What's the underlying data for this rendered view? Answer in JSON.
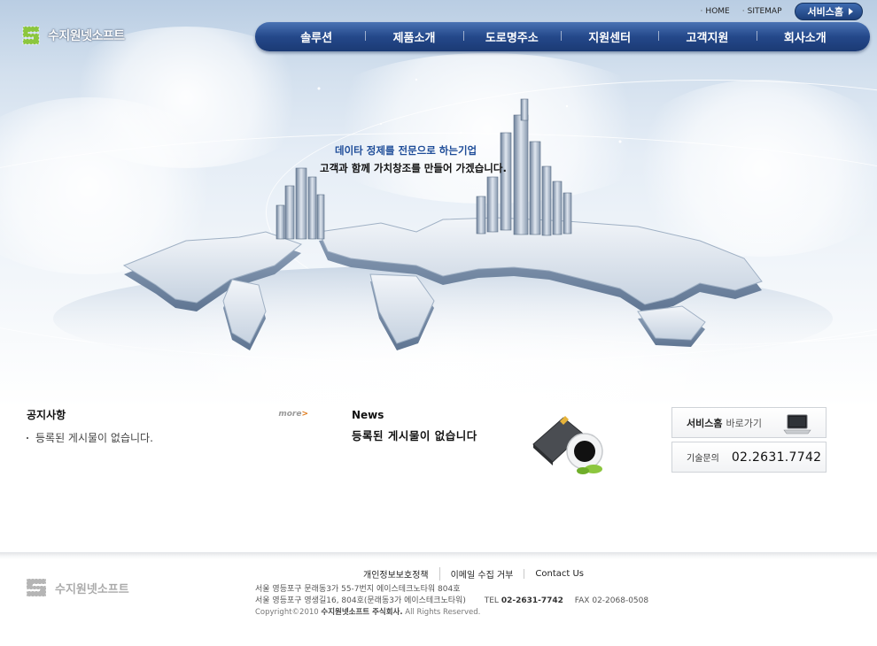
{
  "brand": {
    "name": "수지원넷소프트"
  },
  "utility_nav": {
    "home": "HOME",
    "sitemap": "SITEMAP",
    "service_home": "서비스홈"
  },
  "main_nav": [
    {
      "label": "솔루션"
    },
    {
      "label": "제품소개"
    },
    {
      "label": "도로명주소"
    },
    {
      "label": "지원센터"
    },
    {
      "label": "고객지원"
    },
    {
      "label": "회사소개"
    }
  ],
  "slogan": {
    "line1": "데이타 정제를 전문으로 하는기업",
    "line2": "고객과 함께 가치창조를 만들어 가겠습니다."
  },
  "notice": {
    "title": "공지사항",
    "more": "more",
    "items": [
      "등록된 게시물이 없습니다."
    ]
  },
  "news": {
    "title": "News",
    "empty": "등록된 게시물이 없습니다"
  },
  "quick_link": {
    "strong": "서비스홈",
    "light": "바로가기"
  },
  "tech_support": {
    "label": "기술문의",
    "phone": "02.2631.7742"
  },
  "footer": {
    "brand": "수지원넷소프트",
    "links": [
      "개인정보보호정책",
      "이메일 수집 거부",
      "Contact Us"
    ],
    "address1": "서울 영등포구 문래동3가 55-7번지 에이스테크노타워 804호",
    "address2": "서울 영등포구 영생길16, 804호(문래동3가 에이스테크노타워)",
    "tel_label": "TEL",
    "tel": "02-2631-7742",
    "fax_label": "FAX",
    "fax": "02-2068-0508",
    "copyright_prefix": "Copyright©2010",
    "company": "수지원넷소프트 주식회사.",
    "rights": "All Rights Reserved."
  },
  "colors": {
    "nav_blue": "#24488a",
    "slogan_blue": "#1f4d99",
    "logo_green": "#8cc63e",
    "more_orange": "#e07a1a"
  }
}
